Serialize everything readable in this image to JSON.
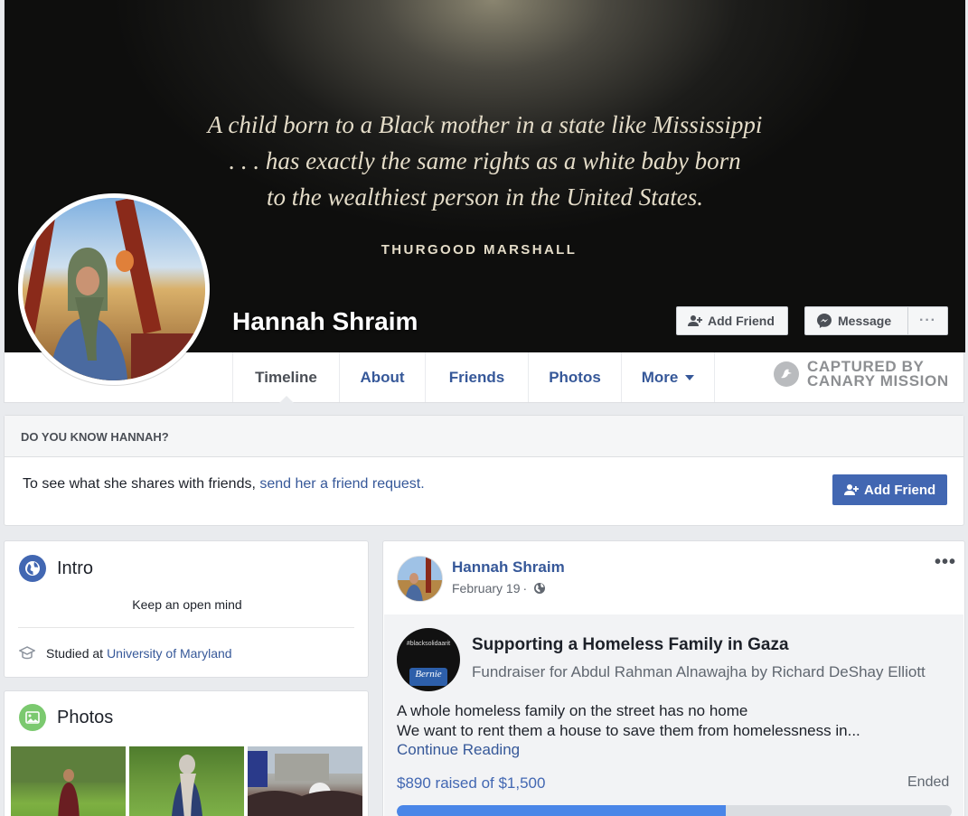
{
  "cover": {
    "quote_lines": [
      "A child born to a Black mother in a state like Mississippi",
      ". . . has exactly the same rights as a white baby born",
      "to the wealthiest person in the United States."
    ],
    "quote_author": "THURGOOD MARSHALL"
  },
  "profile": {
    "name": "Hannah Shraim"
  },
  "actions": {
    "add_friend": "Add Friend",
    "message": "Message",
    "more": "···"
  },
  "tabs": [
    {
      "label": "Timeline",
      "active": true
    },
    {
      "label": "About"
    },
    {
      "label": "Friends"
    },
    {
      "label": "Photos"
    },
    {
      "label": "More"
    }
  ],
  "watermark": {
    "line1": "CAPTURED BY",
    "line2": "CANARY MISSION"
  },
  "know": {
    "heading": "DO YOU KNOW HANNAH?",
    "text": "To see what she shares with friends, ",
    "link": "send her a friend request.",
    "button": "Add Friend"
  },
  "intro": {
    "title": "Intro",
    "bio": "Keep an open mind",
    "school_prefix": "Studied at",
    "school": "University of Maryland"
  },
  "photos": {
    "title": "Photos"
  },
  "post": {
    "author": "Hannah Shraim",
    "date": "February 19",
    "separator": "·",
    "options": "•••",
    "fundraiser": {
      "avatar_tag": "#blacksolidaarit",
      "avatar_badge": "Bernie",
      "title": "Supporting a Homeless Family in Gaza",
      "subtitle": "Fundraiser for Abdul Rahman Alnawajha by Richard DeShay Elliott",
      "desc_line1": "A whole homeless family on the street has no home",
      "desc_line2": "We want to rent them a house to save them from homelessness in...",
      "continue": "Continue Reading",
      "raised_text": "$890 raised of $1,500",
      "raised": 890,
      "goal": 1500,
      "status": "Ended"
    }
  },
  "colors": {
    "brand_blue": "#4267b2",
    "link_blue": "#365899",
    "progress": "#4a86e8"
  },
  "icons": [
    "add-friend-icon",
    "messenger-icon",
    "globe-icon",
    "graduation-cap-icon",
    "photo-icon",
    "canary-icon"
  ]
}
